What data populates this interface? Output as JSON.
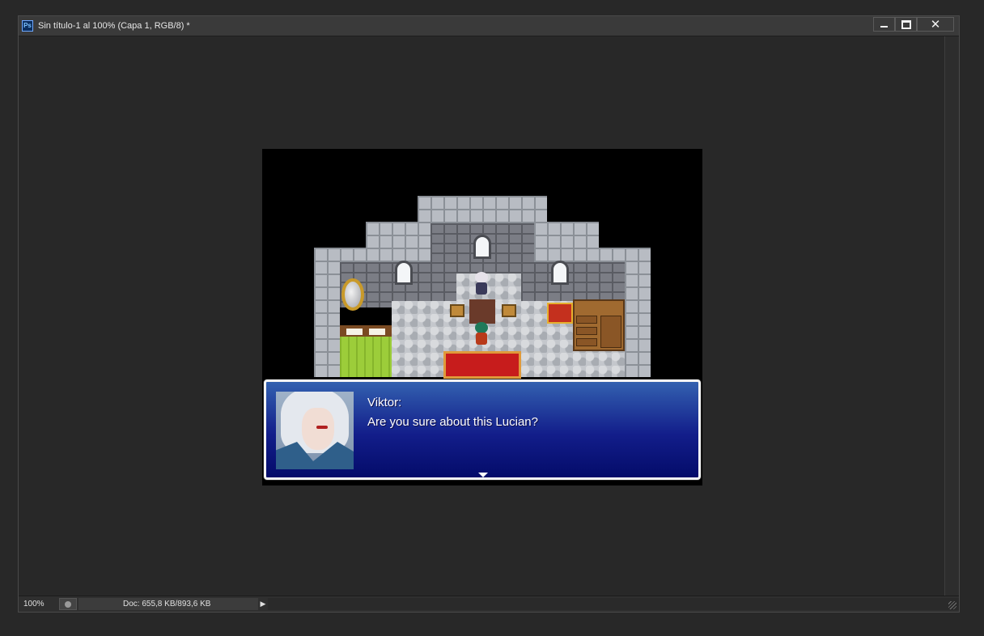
{
  "window": {
    "app_icon": "Ps",
    "title": "Sin título-1 al 100% (Capa 1, RGB/8) *",
    "close_glyph": "✕"
  },
  "statusbar": {
    "zoom": "100%",
    "doc_info": "Doc: 655,8 KB/893,6 KB",
    "arrow": "▶"
  },
  "game": {
    "dialog": {
      "speaker": "Viktor:",
      "text": "Are you sure about this Lucian?"
    }
  },
  "icons": [
    "photoshop-icon",
    "minimize-icon",
    "maximize-icon",
    "close-icon",
    "status-icon",
    "menu-arrow-icon",
    "resize-grip-icon",
    "continue-arrow-icon"
  ]
}
